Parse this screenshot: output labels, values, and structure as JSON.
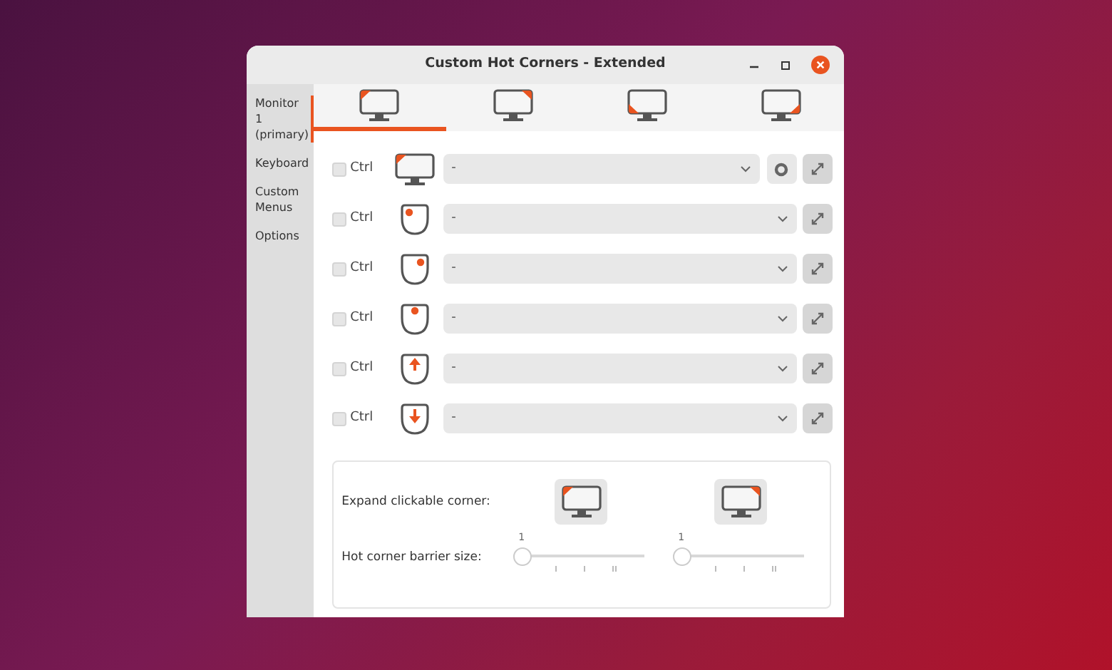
{
  "window": {
    "title": "Custom Hot Corners - Extended"
  },
  "sidebar": {
    "items": [
      {
        "label": "Monitor 1 (primary)",
        "selected": true
      },
      {
        "label": "Keyboard",
        "selected": false
      },
      {
        "label": "Custom Menus",
        "selected": false
      },
      {
        "label": "Options",
        "selected": false
      }
    ]
  },
  "corner_tabs": [
    {
      "kind": "top-left",
      "selected": true
    },
    {
      "kind": "top-right",
      "selected": false
    },
    {
      "kind": "bottom-left",
      "selected": false
    },
    {
      "kind": "bottom-right",
      "selected": false
    }
  ],
  "triggers": [
    {
      "kind": "hover",
      "checked": false,
      "label": "Ctrl",
      "action": "-"
    },
    {
      "kind": "left-click",
      "checked": false,
      "label": "Ctrl",
      "action": "-"
    },
    {
      "kind": "right-click",
      "checked": false,
      "label": "Ctrl",
      "action": "-"
    },
    {
      "kind": "middle-click",
      "checked": false,
      "label": "Ctrl",
      "action": "-"
    },
    {
      "kind": "scroll-up",
      "checked": false,
      "label": "Ctrl",
      "action": "-"
    },
    {
      "kind": "scroll-down",
      "checked": false,
      "label": "Ctrl",
      "action": "-"
    }
  ],
  "expand": {
    "label": "Expand clickable corner:",
    "buttons": [
      {
        "kind": "horizontal"
      },
      {
        "kind": "vertical"
      }
    ]
  },
  "barrier": {
    "label": "Hot corner barrier size:",
    "sliders": [
      {
        "reading": "1",
        "level": 0
      },
      {
        "reading": "1",
        "level": 0
      }
    ]
  }
}
